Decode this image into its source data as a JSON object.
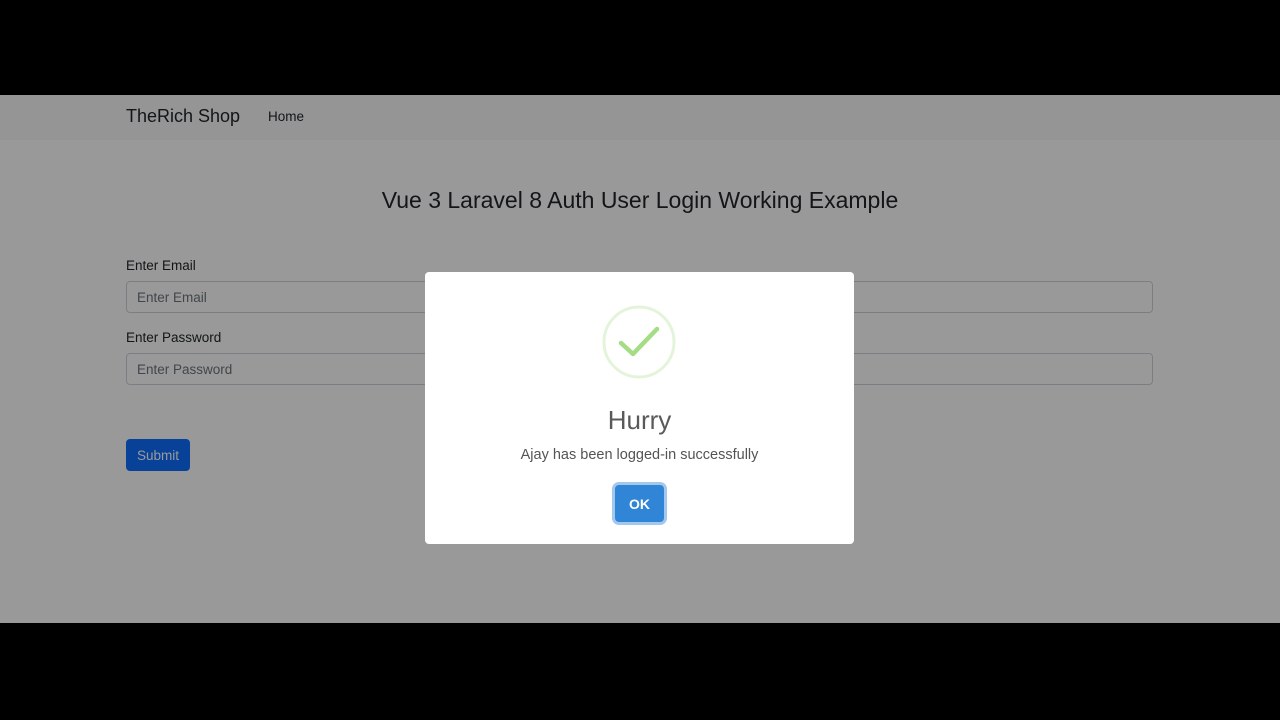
{
  "navbar": {
    "brand": "TheRich Shop",
    "links": [
      {
        "label": "Home"
      }
    ]
  },
  "page": {
    "title": "Vue 3 Laravel 8 Auth User Login Working Example"
  },
  "form": {
    "email": {
      "label": "Enter Email",
      "placeholder": "Enter Email",
      "value": ""
    },
    "password": {
      "label": "Enter Password",
      "placeholder": "Enter Password",
      "value": ""
    },
    "submit_label": "Submit"
  },
  "modal": {
    "icon": "success-check-icon",
    "title": "Hurry",
    "text": "Ajay has been logged-in successfully",
    "ok_label": "OK"
  },
  "colors": {
    "primary": "#0d6efd",
    "confirm": "#3085d6",
    "success": "#a5dc86",
    "overlay": "rgba(0,0,0,0.4)"
  }
}
